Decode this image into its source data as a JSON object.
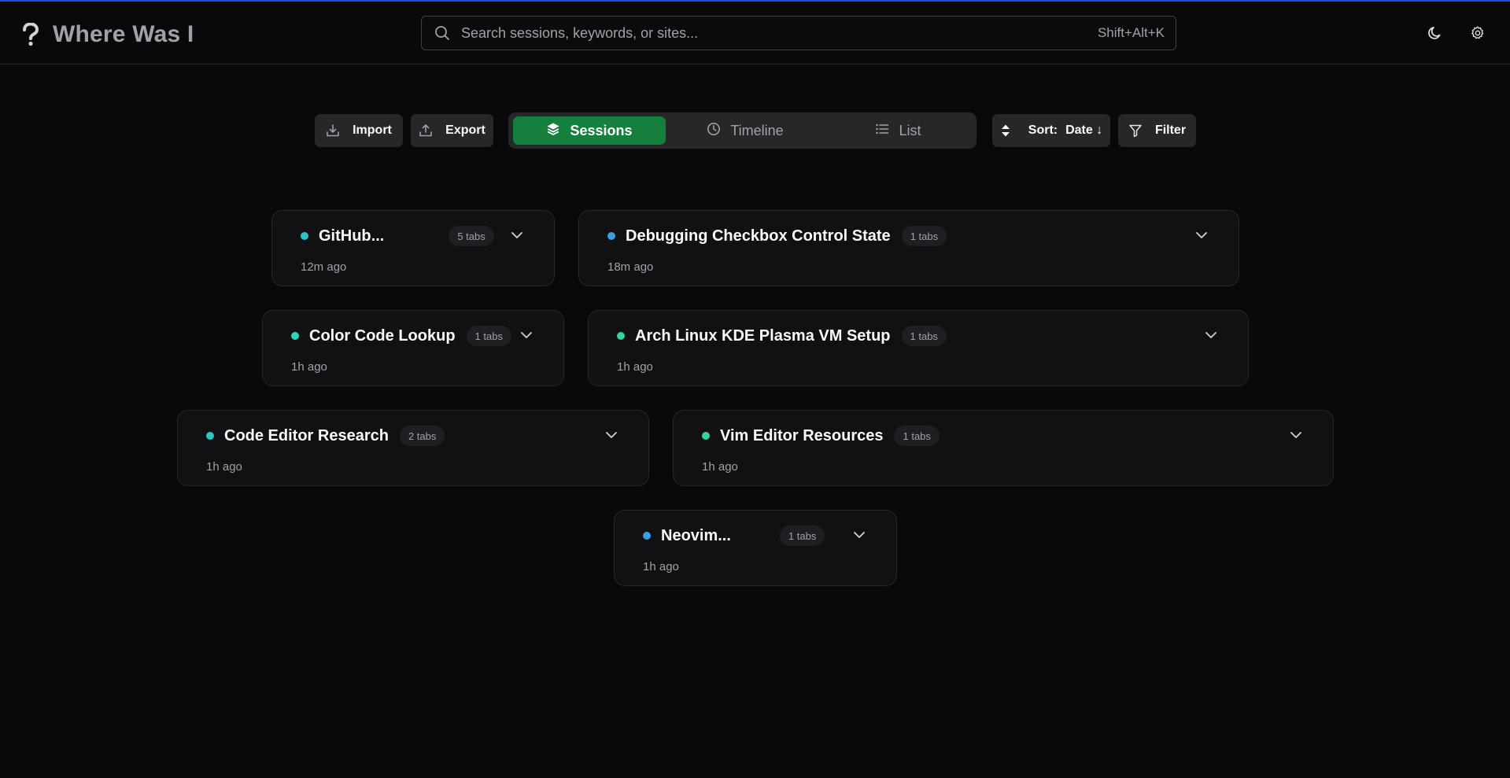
{
  "app": {
    "title": "Where Was I",
    "logo_icon": "question-mark-icon"
  },
  "search": {
    "placeholder": "Search sessions, keywords, or sites...",
    "value": "",
    "shortcut": "Shift+Alt+K"
  },
  "header_actions": {
    "theme_icon": "moon-icon",
    "settings_icon": "gear-icon"
  },
  "toolbar": {
    "import_label": "Import",
    "export_label": "Export",
    "views": [
      {
        "label": "Sessions",
        "icon": "layers-icon",
        "active": true
      },
      {
        "label": "Timeline",
        "icon": "clock-icon",
        "active": false
      },
      {
        "label": "List",
        "icon": "list-icon",
        "active": false
      }
    ],
    "sort_label": "Sort:",
    "sort_value": "Date ↓",
    "filter_label": "Filter"
  },
  "colors": {
    "accent": "#15803d",
    "dot_teal": "#2dd4bf",
    "dot_blue": "#3b9fe6",
    "dot_green": "#34d399",
    "top_line": "#1d4ed8"
  },
  "sessions": [
    {
      "title": "GitHub...",
      "tabs": "5 tabs",
      "time": "12m ago",
      "dot": "#2ec4c4"
    },
    {
      "title": "Debugging Checkbox Control State",
      "tabs": "1 tabs",
      "time": "18m ago",
      "dot": "#3b9fe6"
    },
    {
      "title": "Color Code Lookup",
      "tabs": "1 tabs",
      "time": "1h ago",
      "dot": "#2dd4bf"
    },
    {
      "title": "Arch Linux KDE Plasma VM Setup",
      "tabs": "1 tabs",
      "time": "1h ago",
      "dot": "#34d399"
    },
    {
      "title": "Code Editor Research",
      "tabs": "2 tabs",
      "time": "1h ago",
      "dot": "#2ec4c4"
    },
    {
      "title": "Vim Editor Resources",
      "tabs": "1 tabs",
      "time": "1h ago",
      "dot": "#34d399"
    },
    {
      "title": "Neovim...",
      "tabs": "1 tabs",
      "time": "1h ago",
      "dot": "#3b9fe6"
    }
  ]
}
